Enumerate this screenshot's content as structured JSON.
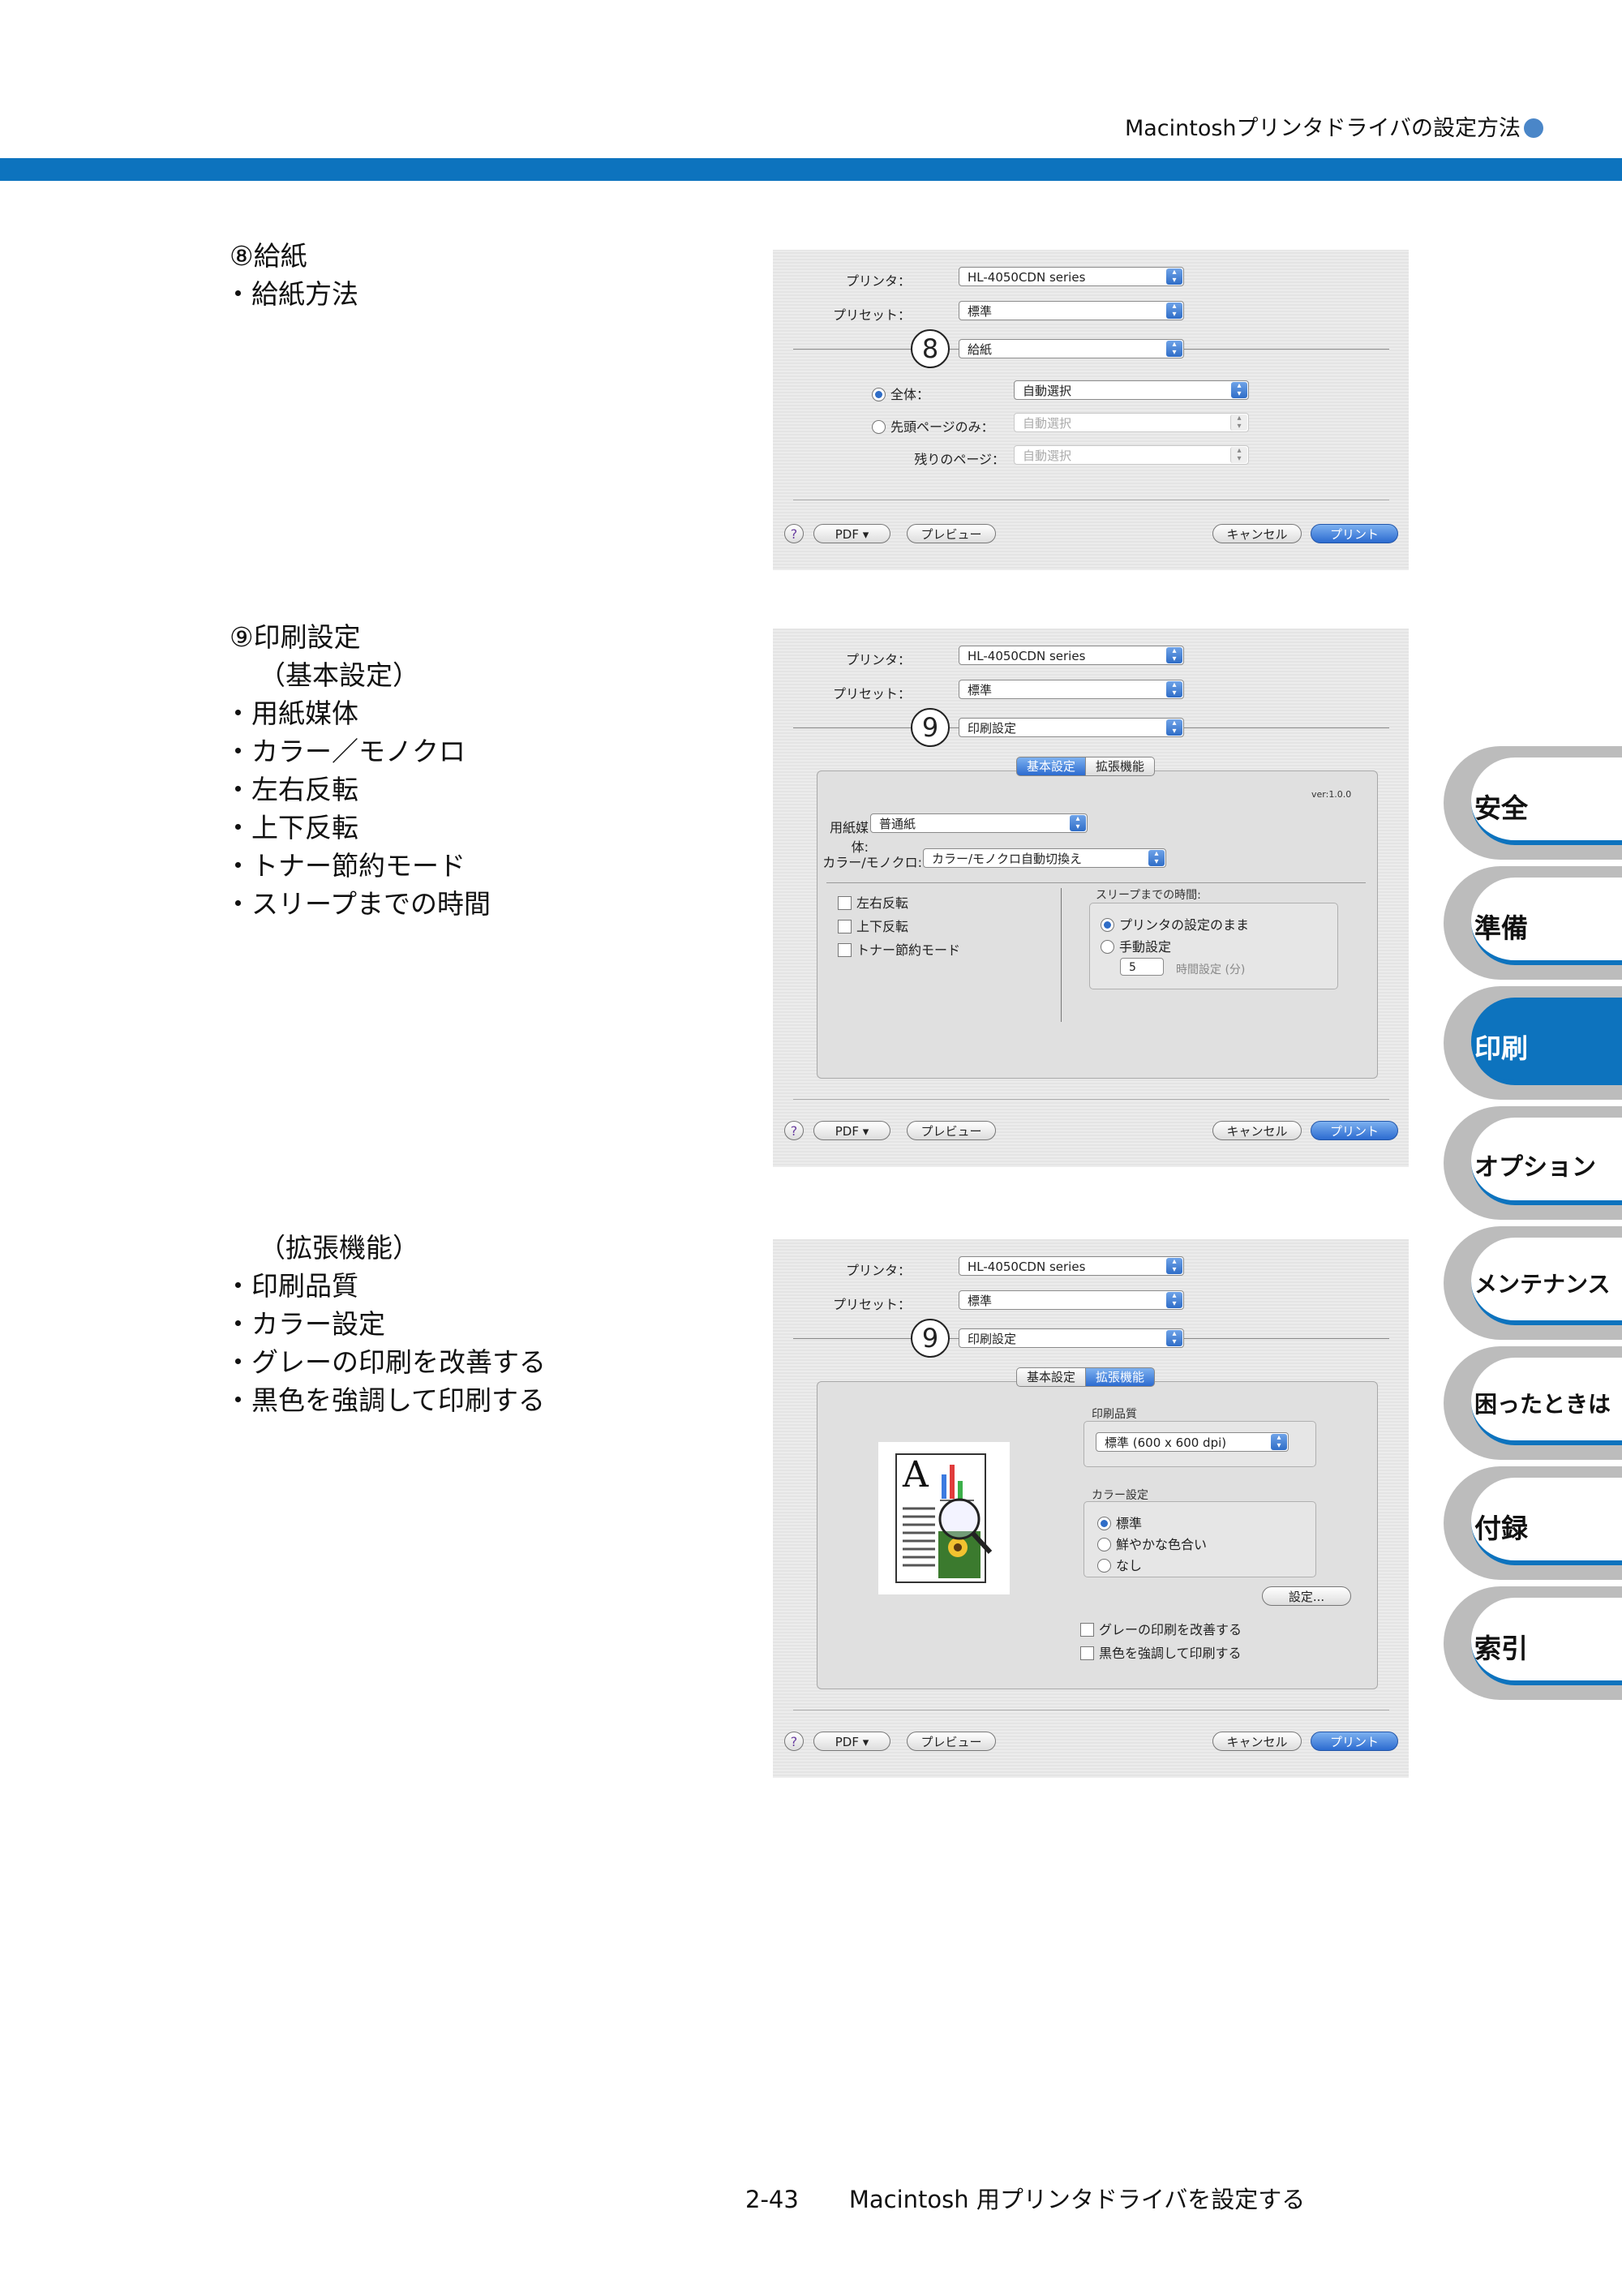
{
  "header": {
    "title": "Macintoshプリンタドライバの設定方法"
  },
  "sections": [
    {
      "head": "⑧給紙",
      "subs": [],
      "items": [
        "給紙方法"
      ]
    },
    {
      "head": "⑨印刷設定",
      "subs": [
        "（基本設定）"
      ],
      "items": [
        "用紙媒体",
        "カラー／モノクロ",
        "左右反転",
        "上下反転",
        "トナー節約モード",
        "スリープまでの時間"
      ]
    },
    {
      "head": "",
      "subs": [
        "（拡張機能）"
      ],
      "items": [
        "印刷品質",
        "カラー設定",
        "グレーの印刷を改善する",
        "黒色を強調して印刷する"
      ]
    }
  ],
  "dialog_common": {
    "printer_label": "プリンタ：",
    "printer_value": "HL-4050CDN series",
    "preset_label": "プリセット：",
    "preset_value": "標準",
    "pdf_button": "PDF ▾",
    "preview_button": "プレビュー",
    "cancel_button": "キャンセル",
    "print_button": "プリント",
    "help": "?"
  },
  "dialog1": {
    "callout": "8",
    "panel_value": "給紙",
    "all_label": "全体：",
    "all_value": "自動選択",
    "first_label": "先頭ページのみ：",
    "first_value": "自動選択",
    "rest_label": "残りのページ：",
    "rest_value": "自動選択"
  },
  "dialog2": {
    "callout": "9",
    "panel_value": "印刷設定",
    "tab_basic": "基本設定",
    "tab_advanced": "拡張機能",
    "version": "ver:1.0.0",
    "media_label": "用紙媒体:",
    "media_value": "普通紙",
    "color_label": "カラー/モノクロ:",
    "color_value": "カラー/モノクロ自動切換え",
    "mirror": "左右反転",
    "flip": "上下反転",
    "toner_save": "トナー節約モード",
    "sleep_title": "スリープまでの時間:",
    "sleep_opt1": "プリンタの設定のまま",
    "sleep_opt2": "手動設定",
    "sleep_value": "5",
    "sleep_unit": "時間設定 (分)"
  },
  "dialog3": {
    "callout": "9",
    "panel_value": "印刷設定",
    "tab_basic": "基本設定",
    "tab_advanced": "拡張機能",
    "quality_title": "印刷品質",
    "quality_value": "標準 (600 x 600 dpi)",
    "color_title": "カラー設定",
    "color_opt1": "標準",
    "color_opt2": "鮮やかな色合い",
    "color_opt3": "なし",
    "settings_button": "設定...",
    "improve_gray": "グレーの印刷を改善する",
    "enhance_black": "黒色を強調して印刷する",
    "preview_letter": "A"
  },
  "side_tabs": [
    {
      "label": "安全",
      "active": false
    },
    {
      "label": "準備",
      "active": false
    },
    {
      "label": "印刷",
      "active": true
    },
    {
      "label": "オプション",
      "active": false
    },
    {
      "label": "メンテナンス",
      "active": false
    },
    {
      "label": "困ったときは",
      "active": false
    },
    {
      "label": "付録",
      "active": false
    },
    {
      "label": "索引",
      "active": false
    }
  ],
  "footer": {
    "page": "2-43",
    "title": "Macintosh 用プリンタドライバを設定する"
  },
  "colors": {
    "accent": "#0d73be",
    "tab_gray": "#bcbcbc"
  }
}
